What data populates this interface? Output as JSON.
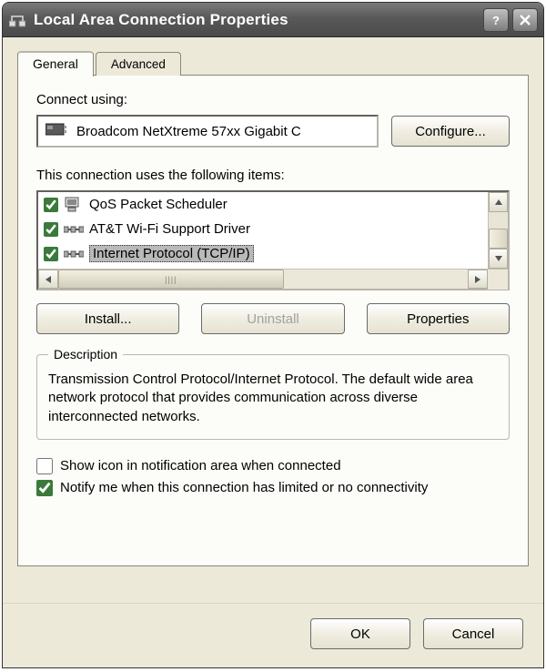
{
  "window": {
    "title": "Local Area Connection Properties"
  },
  "tabs": {
    "general": "General",
    "advanced": "Advanced"
  },
  "connect_using": {
    "label": "Connect using:",
    "adapter": "Broadcom NetXtreme 57xx Gigabit C",
    "configure_button": "Configure..."
  },
  "items_section": {
    "label": "This connection uses the following items:",
    "items": [
      {
        "checked": true,
        "icon": "service",
        "name": "QoS Packet Scheduler",
        "selected": false
      },
      {
        "checked": true,
        "icon": "protocol",
        "name": "AT&T Wi-Fi Support Driver",
        "selected": false
      },
      {
        "checked": true,
        "icon": "protocol",
        "name": "Internet Protocol (TCP/IP)",
        "selected": true
      }
    ],
    "install_button": "Install...",
    "uninstall_button": "Uninstall",
    "properties_button": "Properties"
  },
  "description": {
    "legend": "Description",
    "text": "Transmission Control Protocol/Internet Protocol. The default wide area network protocol that provides communication across diverse interconnected networks."
  },
  "options": {
    "show_icon": {
      "checked": false,
      "label": "Show icon in notification area when connected"
    },
    "notify_limited": {
      "checked": true,
      "label": "Notify me when this connection has limited or no connectivity"
    }
  },
  "dialog_buttons": {
    "ok": "OK",
    "cancel": "Cancel"
  }
}
